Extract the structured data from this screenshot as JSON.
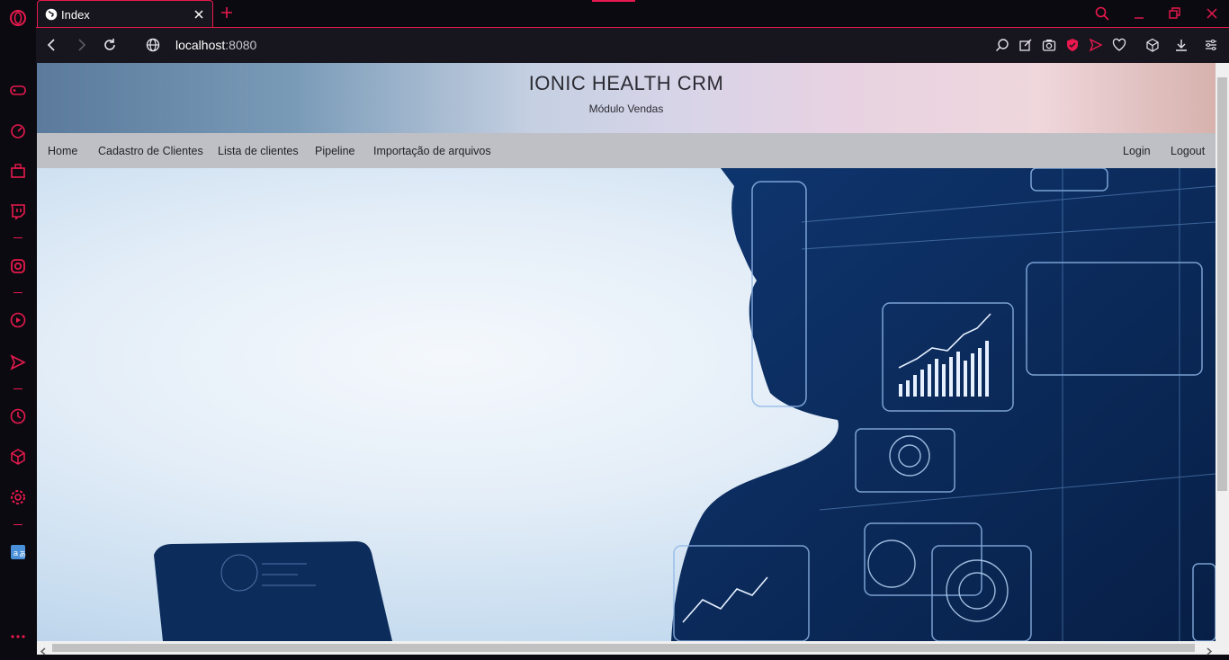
{
  "browser": {
    "tab": {
      "title": "Index"
    },
    "address": {
      "host": "localhost",
      "port": ":8080"
    }
  },
  "site": {
    "title": "IONIC HEALTH CRM",
    "subtitle": "Módulo Vendas",
    "nav_left": [
      "Home",
      "Cadastro de Clientes",
      "Lista de clientes",
      "Pipeline",
      "Importação de arquivos"
    ],
    "nav_right": [
      "Login",
      "Logout"
    ]
  },
  "colors": {
    "accent": "#e8194e",
    "chrome_bg": "#0b0a10",
    "nav_bg": "#bfc0c5",
    "hero_navy": "#0d2d5c"
  }
}
